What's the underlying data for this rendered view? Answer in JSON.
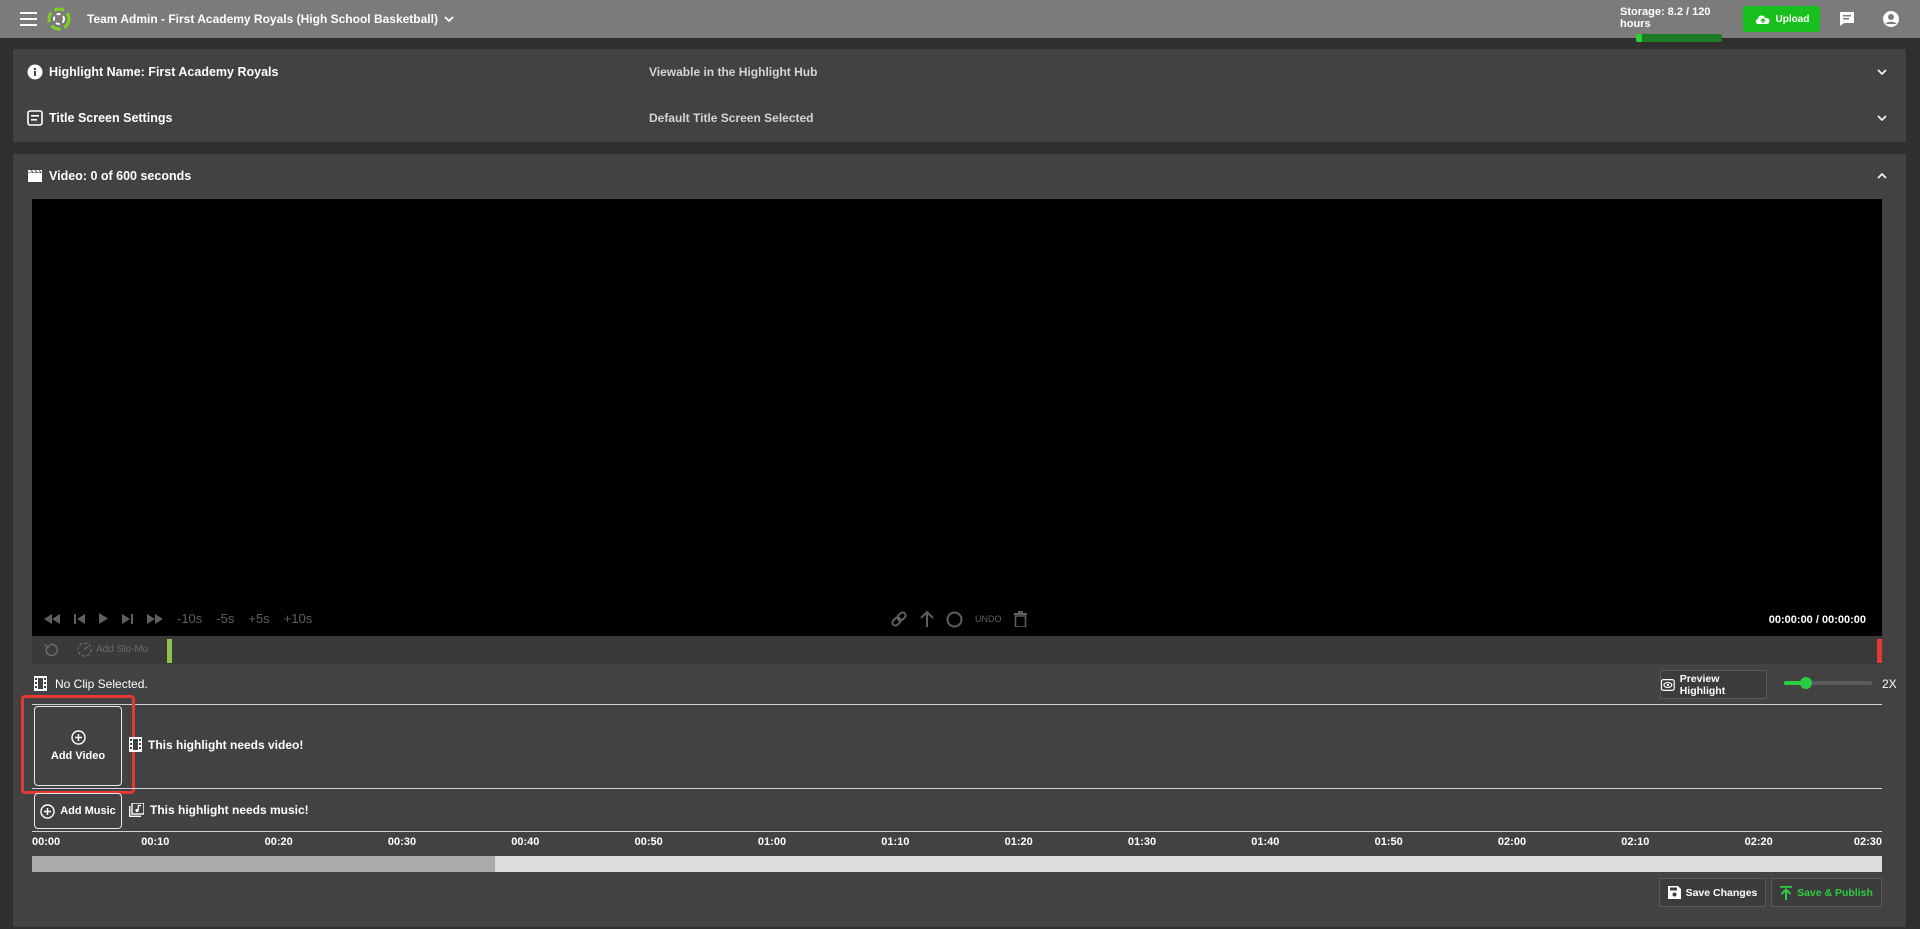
{
  "topbar": {
    "team_title": "Team Admin - First Academy Royals (High School Basketball)",
    "storage_label": "Storage: 8.2 / 120 hours",
    "storage_used_fraction": 0.068,
    "upload_label": "Upload",
    "accent": "#18c01e"
  },
  "settings": {
    "highlight_name_label": "Highlight Name: First Academy Royals",
    "highlight_name_value": "Viewable in the Highlight Hub",
    "title_screen_label": "Title Screen Settings",
    "title_screen_value": "Default Title Screen Selected"
  },
  "video": {
    "header_label": "Video: 0 of 600 seconds",
    "controls": {
      "minus10": "-10s",
      "minus5": "-5s",
      "plus5": "+5s",
      "plus10": "+10s",
      "undo": "UNDO"
    },
    "timecode": "00:00:00 / 00:00:00",
    "slomo_label": "Add Slo-Mo",
    "clip_status": "No Clip Selected.",
    "preview_label": "Preview Highlight",
    "speed_label": "2X",
    "speed_fraction": 0.25,
    "add_video_label": "Add Video",
    "needs_video": "This highlight needs video!",
    "add_music_label": "Add Music",
    "needs_music": "This highlight needs music!",
    "ruler_ticks": [
      "00:00",
      "00:10",
      "00:20",
      "00:30",
      "00:40",
      "00:50",
      "01:00",
      "01:10",
      "01:20",
      "01:30",
      "01:40",
      "01:50",
      "02:00",
      "02:10",
      "02:20",
      "02:30"
    ],
    "timeline_fill_fraction": 0.25,
    "save_label": "Save Changes",
    "publish_label": "Save & Publish"
  }
}
